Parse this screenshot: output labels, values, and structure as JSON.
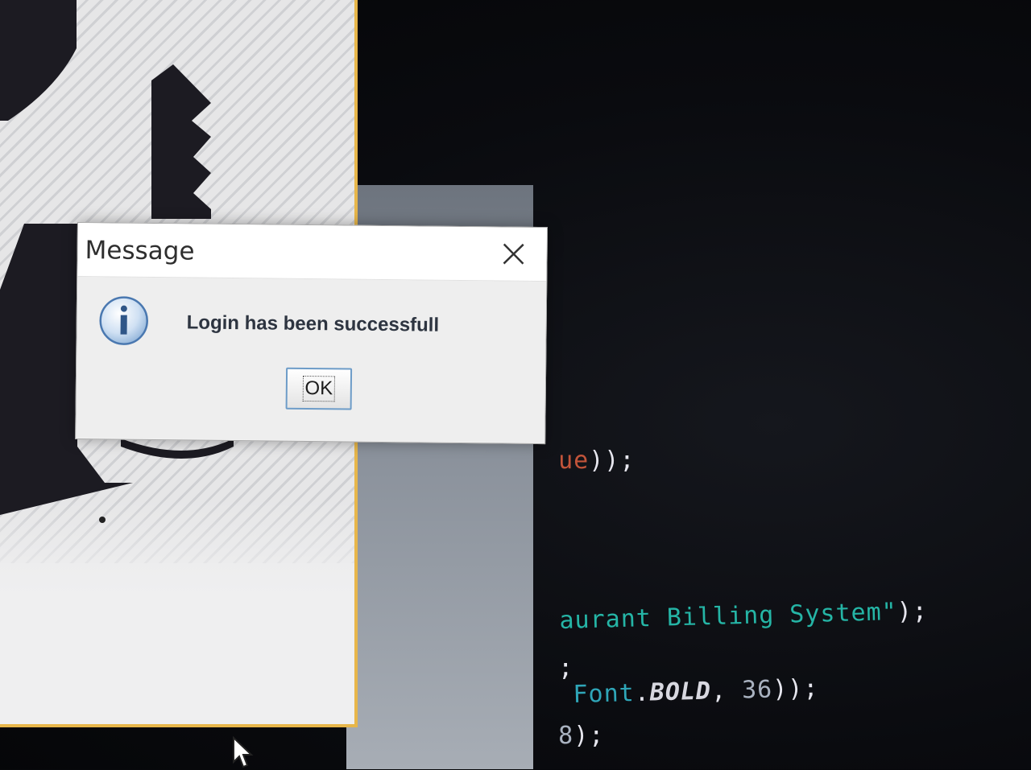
{
  "dialog": {
    "title": "Message",
    "message": "Login has been successfull",
    "ok_label": "OK",
    "icon": "info-icon",
    "close_icon": "close-icon"
  },
  "background_code": {
    "line1_tail": "ue",
    "line1_punct": "));",
    "line2_str": "aurant Billing System\"",
    "line2_punct": ");",
    "line3": ";",
    "line4_cls": "Font",
    "line4_dot": ".",
    "line4_const": "BOLD",
    "line4_comma": ", ",
    "line4_num": "36",
    "line4_punct": "));",
    "line5_num": "8",
    "line5_punct": ");"
  },
  "colors": {
    "string_teal": "#25b5a6",
    "window_border_yellow": "#e7b64a",
    "ok_border_blue": "#6d9cc8"
  }
}
